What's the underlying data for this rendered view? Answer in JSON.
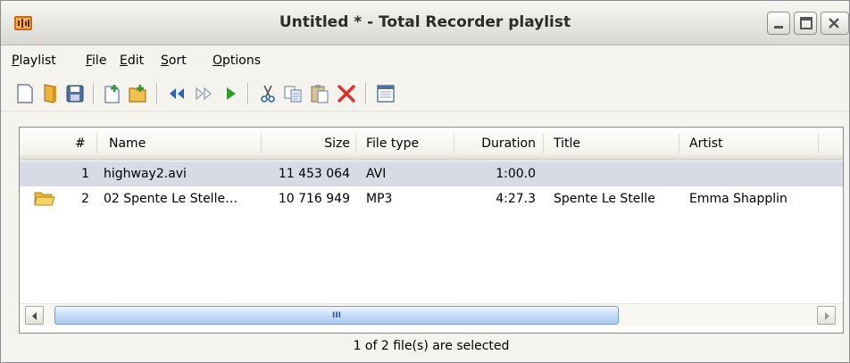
{
  "window": {
    "title": "Untitled * - Total Recorder playlist",
    "app_icon": "total-recorder-icon",
    "controls": [
      "minimize-icon",
      "maximize-icon",
      "close-icon"
    ]
  },
  "menu": {
    "items": [
      {
        "label": "Playlist"
      },
      {
        "label": "File"
      },
      {
        "label": "Edit"
      },
      {
        "label": "Sort"
      },
      {
        "label": "Options"
      }
    ]
  },
  "toolbar": {
    "buttons": [
      "new-playlist-icon",
      "open-playlist-icon",
      "save-icon",
      "add-file-icon",
      "add-folder-icon",
      "previous-icon",
      "next-icon",
      "play-icon",
      "cut-icon",
      "copy-icon",
      "paste-icon",
      "delete-icon",
      "properties-icon"
    ]
  },
  "list": {
    "columns": [
      {
        "label": "#"
      },
      {
        "label": "Name"
      },
      {
        "label": "Size"
      },
      {
        "label": "File type"
      },
      {
        "label": "Duration"
      },
      {
        "label": "Title"
      },
      {
        "label": "Artist"
      }
    ],
    "rows": [
      {
        "num": "1",
        "name": "highway2.avi",
        "size": "11 453 064",
        "type": "AVI",
        "duration": "1:00.0",
        "title": "",
        "artist": "",
        "selected": true,
        "icon": ""
      },
      {
        "num": "2",
        "name": "02 Spente Le Stelle…",
        "size": "10 716 949",
        "type": "MP3",
        "duration": "4:27.3",
        "title": "Spente Le Stelle",
        "artist": "Emma Shapplin",
        "selected": false,
        "icon": "folder-icon"
      }
    ]
  },
  "scrollbar": {
    "thumb_grip": "III"
  },
  "status": {
    "text": "1 of 2 file(s) are selected"
  },
  "colors": {
    "selection": "#d8dbe6",
    "accent": "#316ac5"
  }
}
